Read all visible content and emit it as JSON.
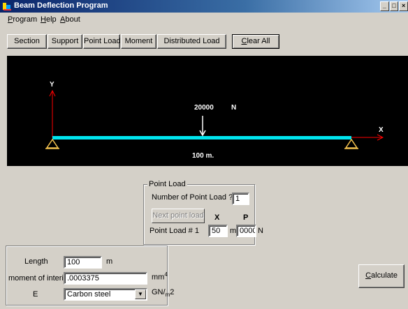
{
  "window": {
    "title": "Beam Deflection Program",
    "controls": {
      "minimize": "_",
      "maximize": "□",
      "close": "×"
    }
  },
  "menu": [
    {
      "mnemonic": "P",
      "rest": "rogram"
    },
    {
      "mnemonic": "H",
      "rest": "elp"
    },
    {
      "mnemonic": "A",
      "rest": "bout"
    }
  ],
  "toolbar": {
    "section": "Section",
    "support": "Support",
    "point_load": "Point Load",
    "moment": "Moment",
    "distributed_load": "Distributed Load",
    "clear_all_mnemonic": "C",
    "clear_all_rest": "lear All"
  },
  "diagram": {
    "y_axis": "Y",
    "x_axis": "X",
    "load_value": "20000",
    "load_unit": "N",
    "beam_length_label": "100 m.",
    "colors": {
      "background": "#000000",
      "beam": "#00e5ee",
      "axes": "#ff0000",
      "supports": "#f2c14e",
      "text": "#ffffff"
    }
  },
  "point_load_panel": {
    "title": "Point Load",
    "count_label": "Number of Point Load ?",
    "count_value": "1",
    "next_button": "Next point load",
    "x_header": "X",
    "p_header": "P",
    "row_label": "Point Load # 1",
    "x_value": "50",
    "x_unit": "m",
    "p_value": "0000",
    "p_unit": "N"
  },
  "section_panel": {
    "length_label": "Length",
    "length_value": "100",
    "length_unit": "m",
    "inertia_label": "moment of interia",
    "inertia_value": ".0003375",
    "inertia_unit_base": "mm",
    "inertia_unit_exp": "4",
    "e_label": "E",
    "e_value": "Carbon steel",
    "e_unit_base": "GN/",
    "e_unit_sub": "m",
    "e_unit_exp": "2"
  },
  "calculate": {
    "mnemonic": "C",
    "rest": "alculate"
  }
}
